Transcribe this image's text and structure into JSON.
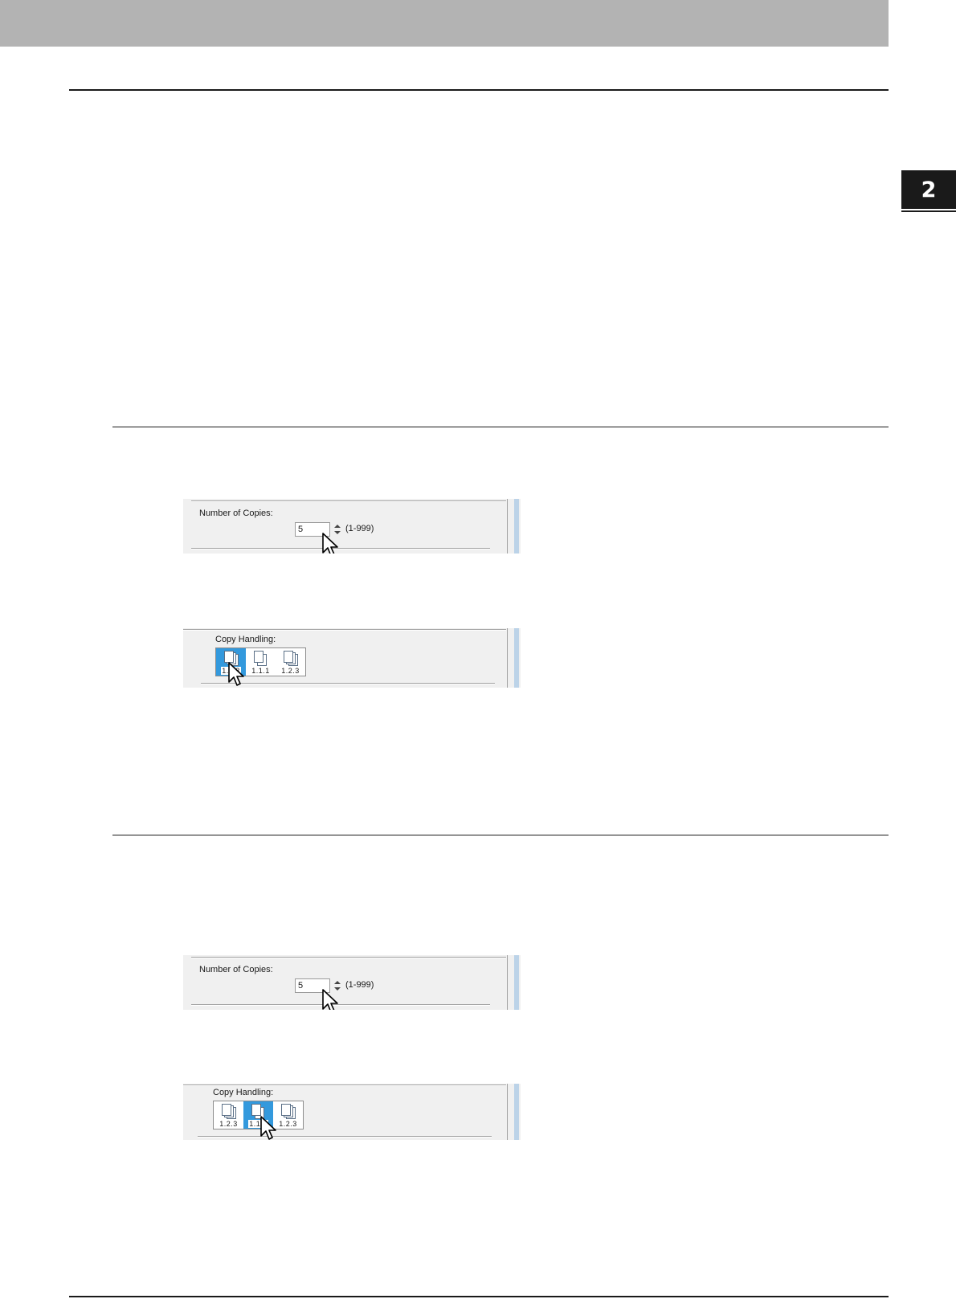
{
  "page": {
    "chapter_number": "2"
  },
  "figures": [
    {
      "type": "copies",
      "label": "Number of Copies:",
      "value": "5",
      "range": "(1-999)"
    },
    {
      "type": "handling",
      "label": "Copy Handling:",
      "options": [
        "1.2.3",
        "1.1.1",
        "1.2.3"
      ],
      "selected_index": 0
    },
    {
      "type": "copies",
      "label": "Number of Copies:",
      "value": "5",
      "range": "(1-999)"
    },
    {
      "type": "handling",
      "label": "Copy Handling:",
      "options": [
        "1.2.3",
        "1.1.1",
        "1.2.3"
      ],
      "selected_index": 1
    }
  ],
  "icons": {
    "cursor": "mouse-pointer-icon",
    "spinner": "up-down-arrows-icon",
    "copy_handling": "paper-stack-icon"
  }
}
